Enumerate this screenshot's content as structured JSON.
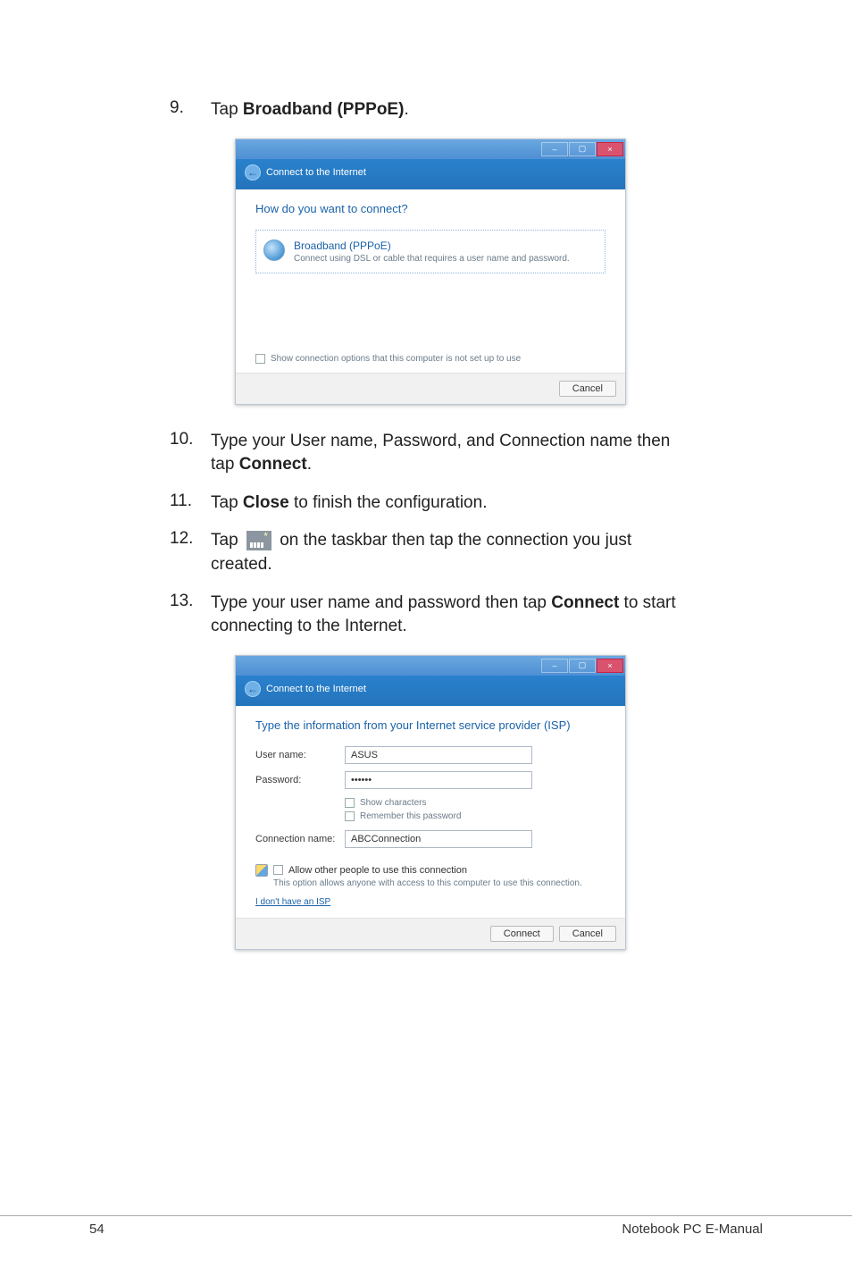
{
  "steps": {
    "s9": {
      "num": "9.",
      "text_pre": "Tap ",
      "bold": "Broadband (PPPoE)",
      "text_post": "."
    },
    "s10": {
      "num": "10.",
      "text_pre": "Type your User name, Password, and Connection name then tap ",
      "bold": "Connect",
      "text_post": "."
    },
    "s11": {
      "num": "11.",
      "text_pre": "Tap ",
      "bold": "Close",
      "text_post": " to finish the configuration."
    },
    "s12": {
      "num": "12.",
      "text_pre": "Tap ",
      "text_post_a": " on the taskbar then tap the connection you just created."
    },
    "s13": {
      "num": "13.",
      "text_pre": "Type your user name and password then tap ",
      "bold": "Connect",
      "text_post": " to start connecting to the Internet."
    }
  },
  "dialog1": {
    "crumb_icon": "←",
    "crumb": "Connect to the Internet",
    "heading": "How do you want to connect?",
    "option_title": "Broadband (PPPoE)",
    "option_sub": "Connect using DSL or cable that requires a user name and password.",
    "show_chk": "Show connection options that this computer is not set up to use",
    "cancel": "Cancel"
  },
  "dialog2": {
    "crumb": "Connect to the Internet",
    "heading": "Type the information from your Internet service provider (ISP)",
    "username_label": "User name:",
    "username_value": "ASUS",
    "password_label": "Password:",
    "password_value": "••••••",
    "show_chars": "Show characters",
    "remember": "Remember this password",
    "conn_label": "Connection name:",
    "conn_value": "ABCConnection",
    "allow_label": "Allow other people to use this connection",
    "allow_desc": "This option allows anyone with access to this computer to use this connection.",
    "isp_link": "I don't have an ISP",
    "connect": "Connect",
    "cancel": "Cancel"
  },
  "footer": {
    "page": "54",
    "title": "Notebook PC E-Manual"
  }
}
